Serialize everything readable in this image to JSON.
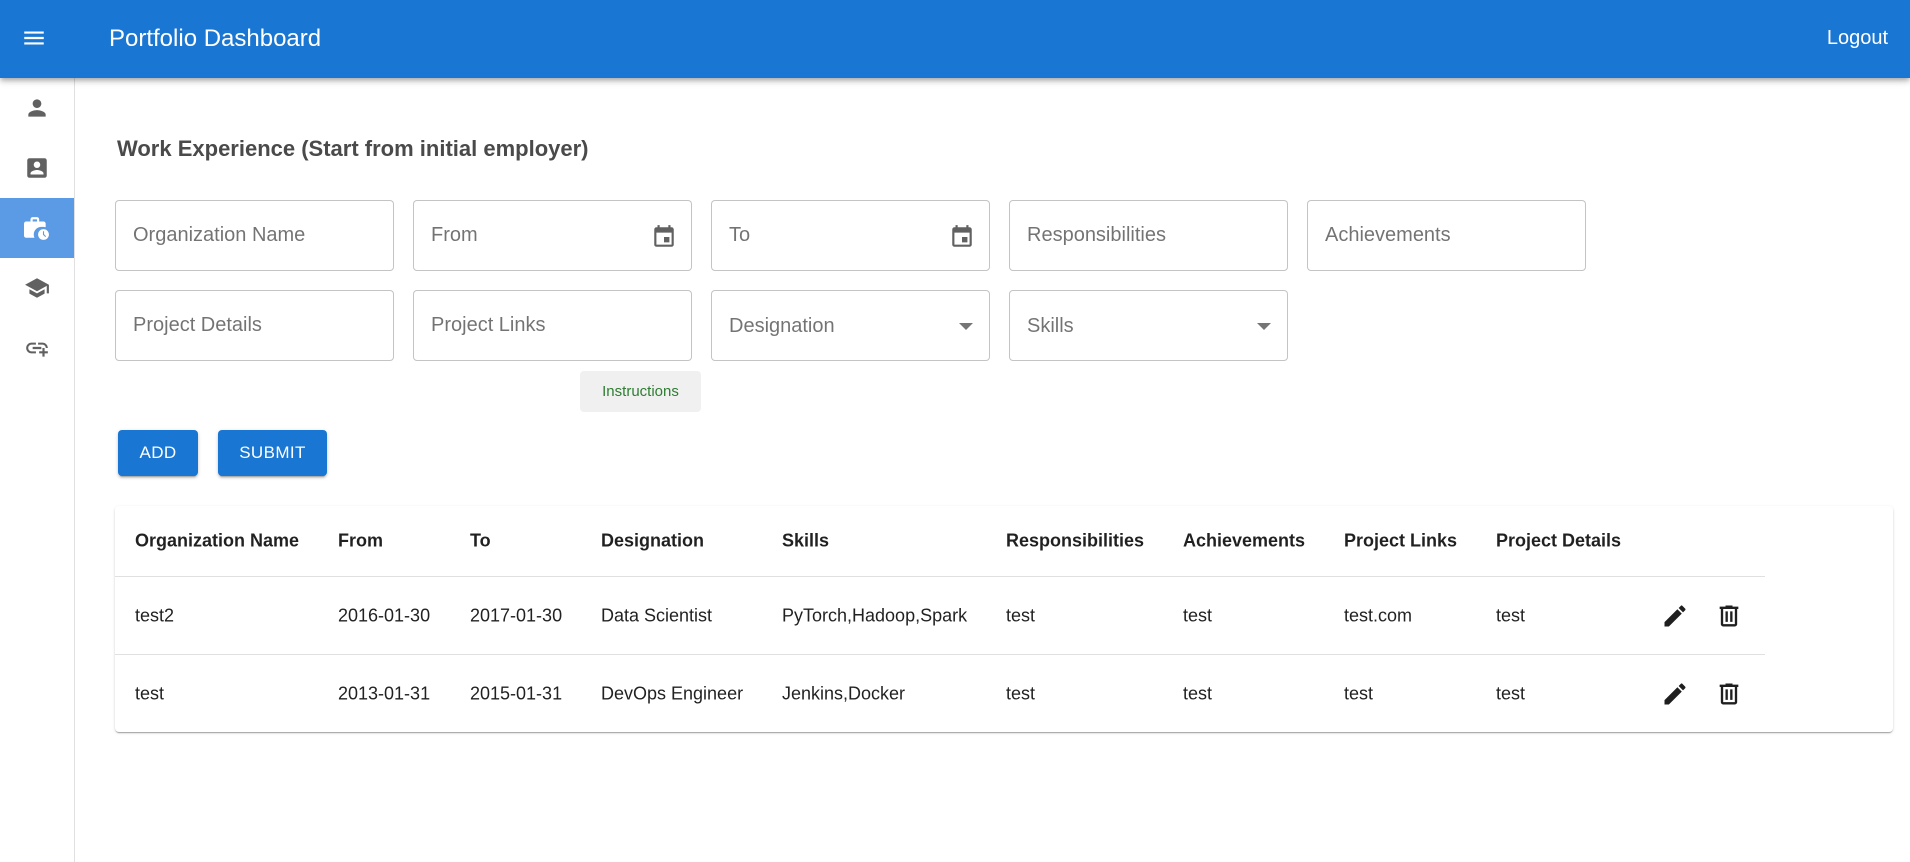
{
  "app": {
    "title": "Portfolio Dashboard",
    "logout_label": "Logout",
    "brand_color": "#1976d2"
  },
  "sidebar": {
    "items": [
      {
        "icon": "person-icon",
        "active": false
      },
      {
        "icon": "contact-card-icon",
        "active": false
      },
      {
        "icon": "work-history-icon",
        "active": true
      },
      {
        "icon": "school-icon",
        "active": false
      },
      {
        "icon": "add-link-icon",
        "active": false
      }
    ]
  },
  "form": {
    "title": "Work Experience (Start from initial employer)",
    "fields": {
      "organization": {
        "placeholder": "Organization Name",
        "value": ""
      },
      "from": {
        "placeholder": "From",
        "value": ""
      },
      "to": {
        "placeholder": "To",
        "value": ""
      },
      "responsibilities": {
        "placeholder": "Responsibilities",
        "value": ""
      },
      "achievements": {
        "placeholder": "Achievements",
        "value": ""
      },
      "project_details": {
        "placeholder": "Project Details",
        "value": ""
      },
      "project_links": {
        "placeholder": "Project Links",
        "value": ""
      },
      "designation": {
        "label": "Designation"
      },
      "skills": {
        "label": "Skills"
      }
    },
    "instructions_label": "Instructions",
    "add_label": "ADD",
    "submit_label": "SUBMIT"
  },
  "table": {
    "headers": [
      "Organization Name",
      "From",
      "To",
      "Designation",
      "Skills",
      "Responsibilities",
      "Achievements",
      "Project Links",
      "Project Details"
    ],
    "rows": [
      [
        "test2",
        "2016-01-30",
        "2017-01-30",
        "Data Scientist",
        "PyTorch,Hadoop,Spark",
        "test",
        "test",
        "test.com",
        "test"
      ],
      [
        "test",
        "2013-01-31",
        "2015-01-31",
        "DevOps Engineer",
        "Jenkins,Docker",
        "test",
        "test",
        "test",
        "test"
      ]
    ]
  }
}
